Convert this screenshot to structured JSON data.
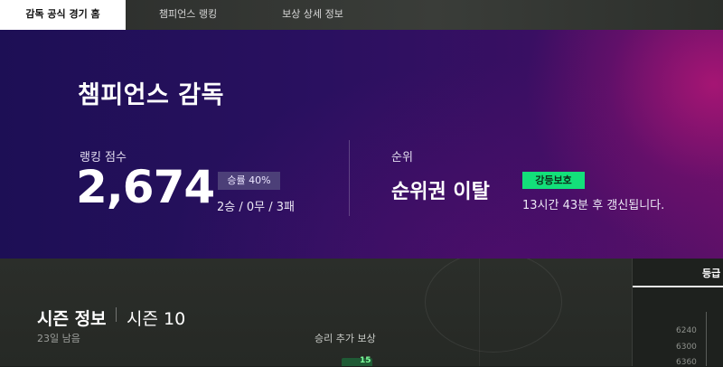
{
  "tabs": [
    {
      "label": "감독 공식 경기 홈",
      "active": true
    },
    {
      "label": "챔피언스 랭킹",
      "active": false
    },
    {
      "label": "보상 상세 정보",
      "active": false
    }
  ],
  "hero": {
    "title": "챔피언스 감독",
    "score_label": "랭킹 점수",
    "score": "2,674",
    "win_rate_badge": "승률 40%",
    "record": "2승 / 0무 / 3패",
    "rank_label": "순위",
    "rank_status": "순위권 이탈",
    "rank_badge": "강등보호",
    "refresh_note": "13시간 43분 후 갱신됩니다."
  },
  "season": {
    "title": "시즌 정보",
    "name": "시즌 10",
    "days_left": "23일 남음",
    "reward_label": "승리 추가 보상",
    "reward_value": "15"
  },
  "grade_panel": {
    "header": "등급",
    "ticks": [
      "6240",
      "6300",
      "6360"
    ]
  },
  "colors": {
    "accent_green": "#13e07a",
    "hero_purple": "#2a1060",
    "hero_magenta": "#b21676"
  }
}
